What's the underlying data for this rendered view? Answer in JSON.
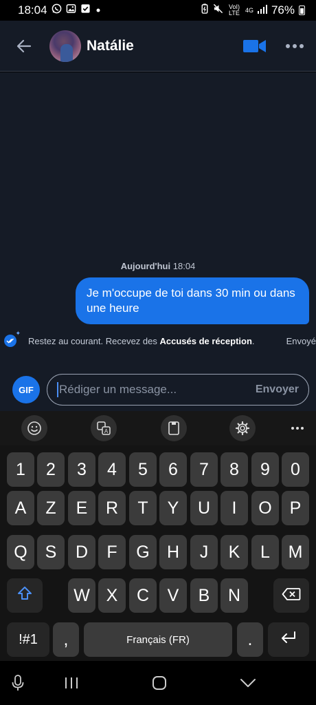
{
  "status_bar": {
    "time": "18:04",
    "notification_icons": [
      "whatsapp-icon",
      "gallery-icon",
      "checkbox-icon",
      "dot-icon"
    ],
    "system_icons": [
      "battery-saver-icon",
      "mute-icon",
      "volte-icon",
      "4g-icon",
      "signal-icon"
    ],
    "volte_label": "VoI) LTE",
    "network_label": "4G",
    "battery": "76%"
  },
  "header": {
    "contact_name": "Natálie",
    "icons": [
      "back-arrow-icon",
      "video-call-icon",
      "more-icon"
    ]
  },
  "conversation": {
    "date_label": "Aujourd'hui",
    "date_time": "18:04",
    "message": "Je m'occupe de toi dans 30 min ou dans une heure",
    "receipt_prefix": "Restez au courant. Recevez des ",
    "receipt_bold": "Accusés de réception",
    "receipt_suffix": ".",
    "sent_status": "Envoyé"
  },
  "composer": {
    "gif_label": "GIF",
    "placeholder": "Rédiger un message...",
    "send_label": "Envoyer"
  },
  "keyboard_toolbar": {
    "icons": [
      "emoji-icon",
      "translate-icon",
      "clipboard-icon",
      "settings-icon",
      "more-icon"
    ]
  },
  "keyboard": {
    "row1": [
      "1",
      "2",
      "3",
      "4",
      "5",
      "6",
      "7",
      "8",
      "9",
      "0"
    ],
    "row2": [
      "A",
      "Z",
      "E",
      "R",
      "T",
      "Y",
      "U",
      "I",
      "O",
      "P"
    ],
    "row3": [
      "Q",
      "S",
      "D",
      "F",
      "G",
      "H",
      "J",
      "K",
      "L",
      "M"
    ],
    "row4": [
      "W",
      "X",
      "C",
      "V",
      "B",
      "N"
    ],
    "symbols_label": "!#1",
    "comma_label": ",",
    "space_label": "Français (FR)",
    "period_label": ".",
    "icons": [
      "shift-icon",
      "backspace-icon",
      "enter-icon"
    ]
  },
  "nav_bar": {
    "icons": [
      "mic-icon",
      "recent-apps-icon",
      "home-icon",
      "back-chevron-icon"
    ]
  },
  "colors": {
    "accent": "#1a73e8",
    "chat_background": "#151b26",
    "keyboard_background": "#141414",
    "key": "#3b3b3b"
  }
}
